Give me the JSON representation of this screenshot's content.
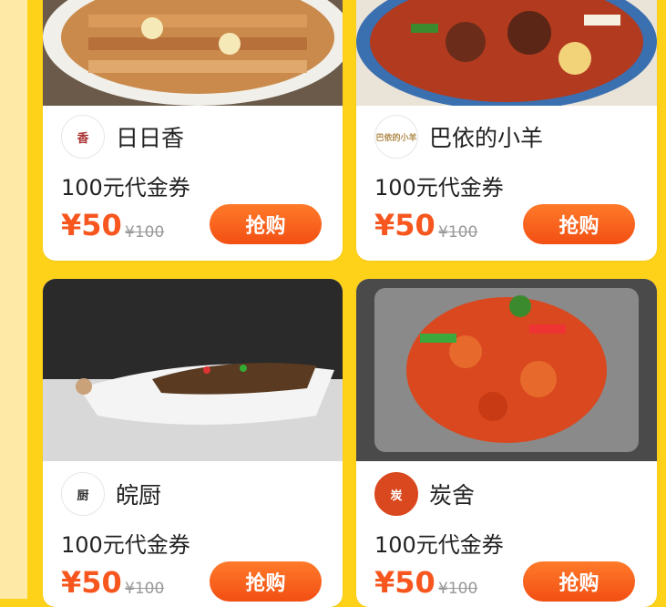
{
  "cards": [
    {
      "merchant": "日日香",
      "logo_text": "香",
      "voucher": "100元代金券",
      "price": "¥50",
      "original_price": "¥100",
      "buy_label": "抢购"
    },
    {
      "merchant": "巴依的小羊",
      "logo_text": "巴依的小羊",
      "voucher": "100元代金券",
      "price": "¥50",
      "original_price": "¥100",
      "buy_label": "抢购"
    },
    {
      "merchant": "皖厨",
      "logo_text": "厨",
      "voucher": "100元代金券",
      "price": "¥50",
      "original_price": "¥100",
      "buy_label": "抢购"
    },
    {
      "merchant": "炭舍",
      "logo_text": "炭",
      "voucher": "100元代金券",
      "price": "¥50",
      "original_price": "¥100",
      "buy_label": "抢购"
    }
  ],
  "colors": {
    "background": "#FFD21A",
    "price": "#F7561E",
    "button": "#F24F13"
  }
}
